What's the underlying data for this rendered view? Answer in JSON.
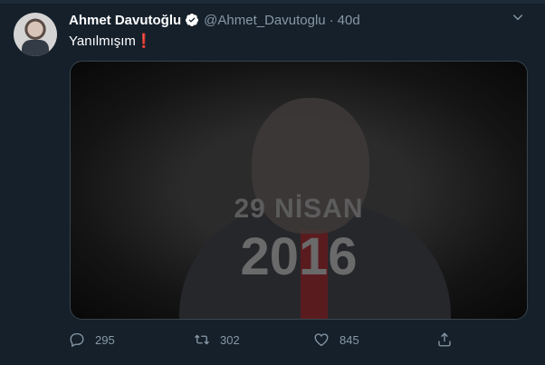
{
  "author": {
    "name": "Ahmet Davutoğlu",
    "handle": "@Ahmet_Davutoglu",
    "separator": "·",
    "age": "40d",
    "verified": true
  },
  "tweet": {
    "text": "Yanılmışım",
    "emoji": "❗"
  },
  "media": {
    "overlay_line1": "29 NİSAN",
    "overlay_line2": "2016"
  },
  "actions": {
    "reply_count": "295",
    "retweet_count": "302",
    "like_count": "845"
  },
  "colors": {
    "background": "#15202b",
    "secondary_text": "#8899a6",
    "emoji_red": "#e0243b"
  },
  "icons": [
    "chevron-down-icon",
    "verified-badge-icon",
    "reply-icon",
    "retweet-icon",
    "like-icon",
    "share-icon"
  ]
}
